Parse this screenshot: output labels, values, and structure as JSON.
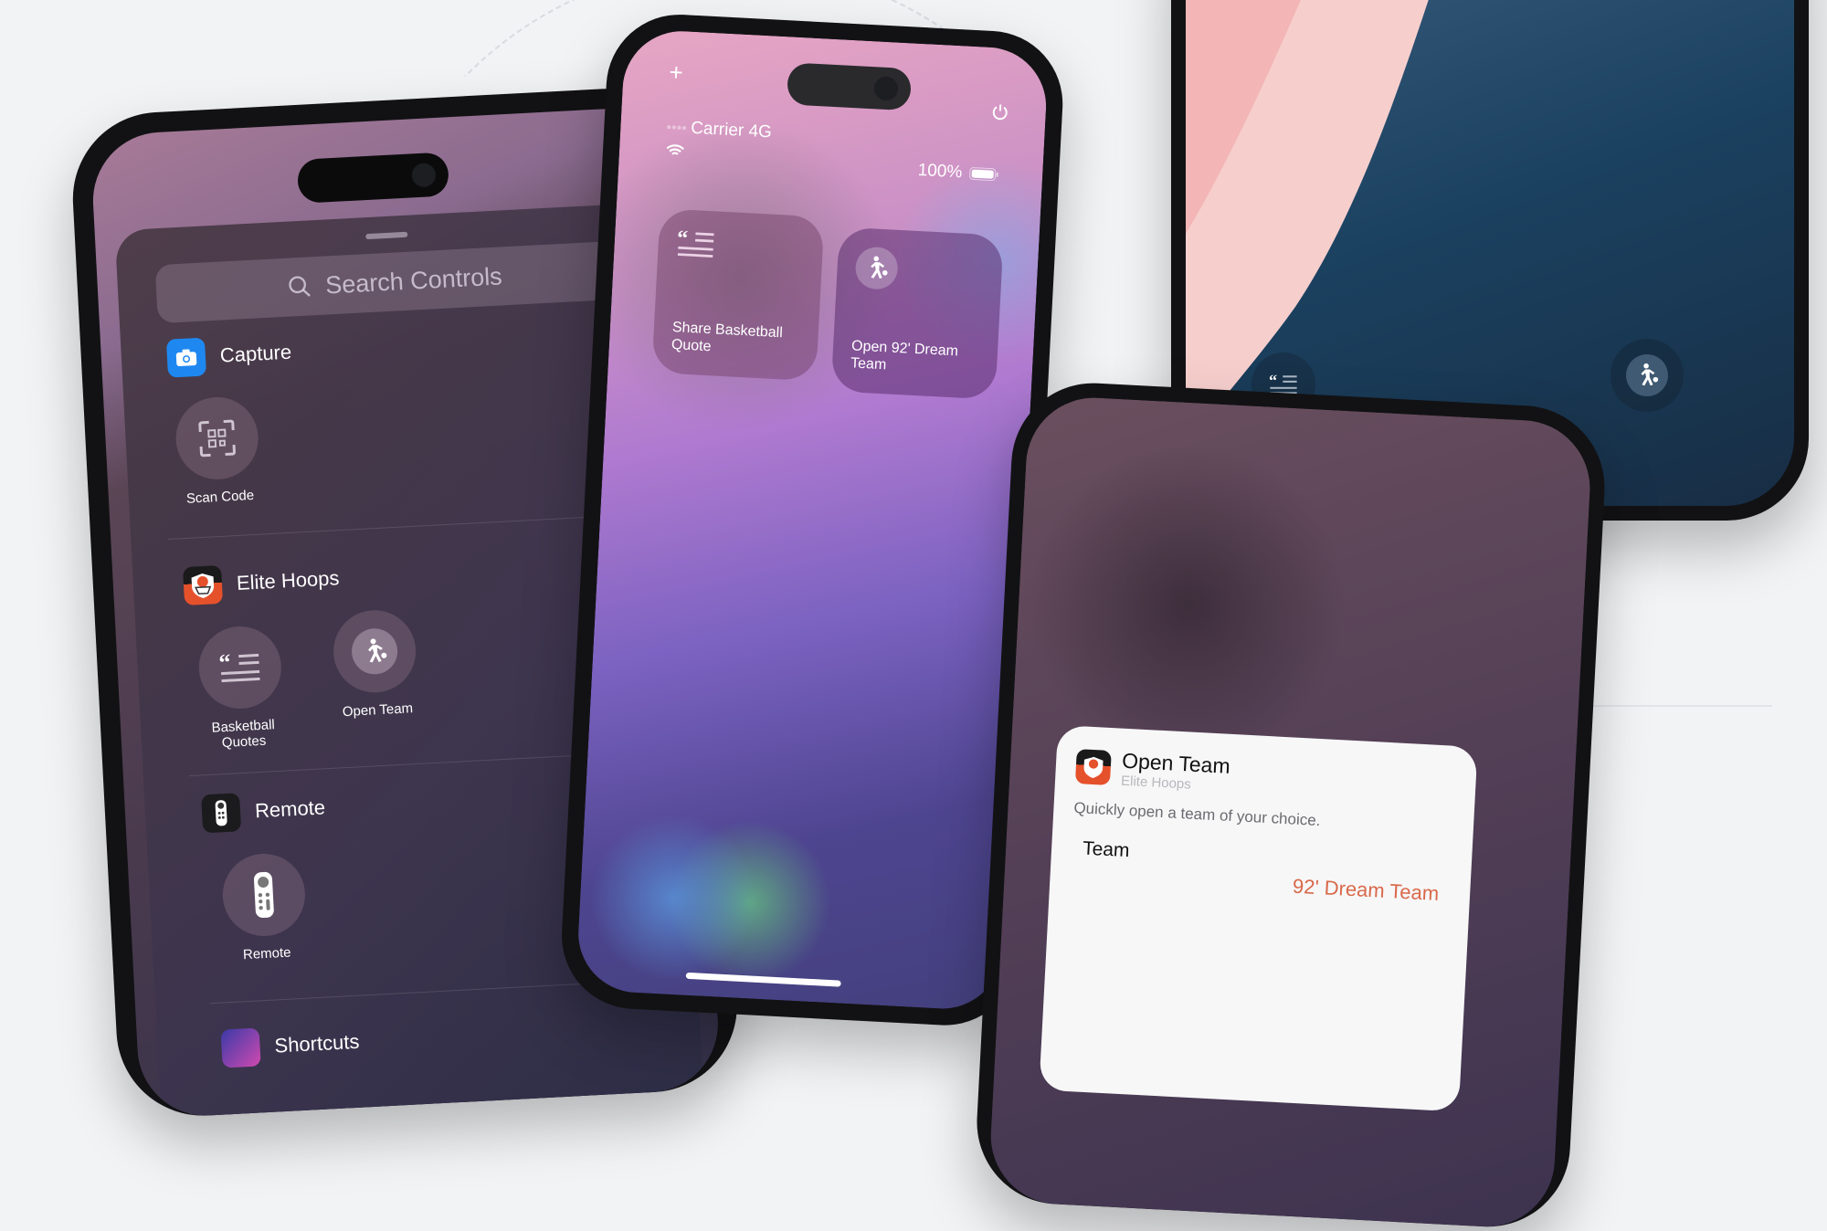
{
  "left_phone": {
    "search_placeholder": "Search Controls",
    "sections": [
      {
        "title": "Capture",
        "icon": "camera-icon",
        "controls": [
          {
            "label": "Scan Code",
            "icon": "qr-scan-icon"
          }
        ]
      },
      {
        "title": "Elite Hoops",
        "icon": "elite-hoops-app-icon",
        "controls": [
          {
            "label": "Basketball Quotes",
            "icon": "quote-lines-icon"
          },
          {
            "label": "Open Team",
            "icon": "basketball-player-icon"
          }
        ]
      },
      {
        "title": "Remote",
        "icon": "remote-app-icon",
        "controls": [
          {
            "label": "Remote",
            "icon": "remote-icon"
          }
        ]
      },
      {
        "title": "Shortcuts",
        "icon": "shortcuts-app-icon",
        "controls": []
      }
    ]
  },
  "middle_phone": {
    "add_symbol": "+",
    "carrier": "Carrier 4G",
    "battery": "100%",
    "tiles": [
      {
        "label": "Share Basketball Quote",
        "icon": "quote-lines-icon"
      },
      {
        "label": "Open 92' Dream Team",
        "icon": "basketball-player-icon"
      }
    ]
  },
  "lock_phone": {
    "left_control_icon": "quote-lines-icon",
    "right_control_icon": "basketball-player-icon"
  },
  "config_card": {
    "title": "Open Team",
    "app_name": "Elite Hoops",
    "description": "Quickly open a team of your choice.",
    "field_label": "Team",
    "field_value": "92' Dream Team",
    "accent_color": "#d9694a"
  }
}
